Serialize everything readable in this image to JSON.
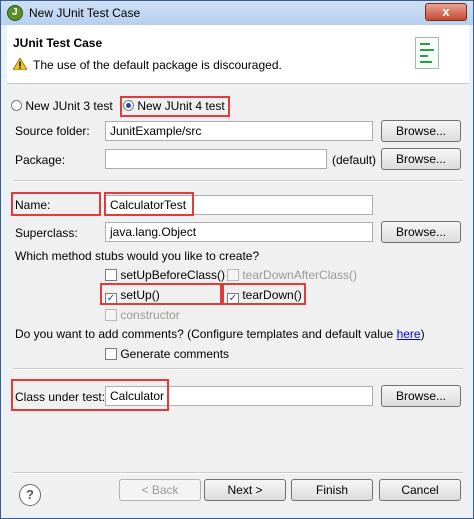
{
  "window": {
    "title": "New JUnit Test Case",
    "close_symbol": "x"
  },
  "header": {
    "title": "JUnit Test Case",
    "message": "The use of the default package is discouraged."
  },
  "junit_version": {
    "option3": "New JUnit 3 test",
    "option4": "New JUnit 4 test",
    "selected": "New JUnit 4 test"
  },
  "source_folder": {
    "label": "Source folder:",
    "value": "JunitExample/src",
    "browse": "Browse..."
  },
  "package": {
    "label": "Package:",
    "value": "",
    "suffix": "(default)",
    "browse": "Browse..."
  },
  "name": {
    "label": "Name:",
    "value": "CalculatorTest"
  },
  "superclass": {
    "label": "Superclass:",
    "value": "java.lang.Object",
    "browse": "Browse..."
  },
  "stubs": {
    "question": "Which method stubs would you like to create?",
    "setUpBeforeClass": {
      "label": "setUpBeforeClass()",
      "checked": false
    },
    "tearDownAfterClass": {
      "label": "tearDownAfterClass()",
      "checked": false,
      "enabled": false
    },
    "setUp": {
      "label": "setUp()",
      "checked": true
    },
    "tearDown": {
      "label": "tearDown()",
      "checked": true
    },
    "constructor": {
      "label": "constructor",
      "checked": false,
      "enabled": false
    }
  },
  "comments": {
    "question": "Do you want to add comments? (Configure templates and default value ",
    "link": "here",
    "close": ")",
    "generate": "Generate comments"
  },
  "class_under_test": {
    "label": "Class under test:",
    "value": "Calculator",
    "browse": "Browse..."
  },
  "footer": {
    "help": "?",
    "back": "< Back",
    "next": "Next >",
    "finish": "Finish",
    "cancel": "Cancel"
  },
  "colors": {
    "highlight": "#e03c3c",
    "link": "#0000ee"
  }
}
